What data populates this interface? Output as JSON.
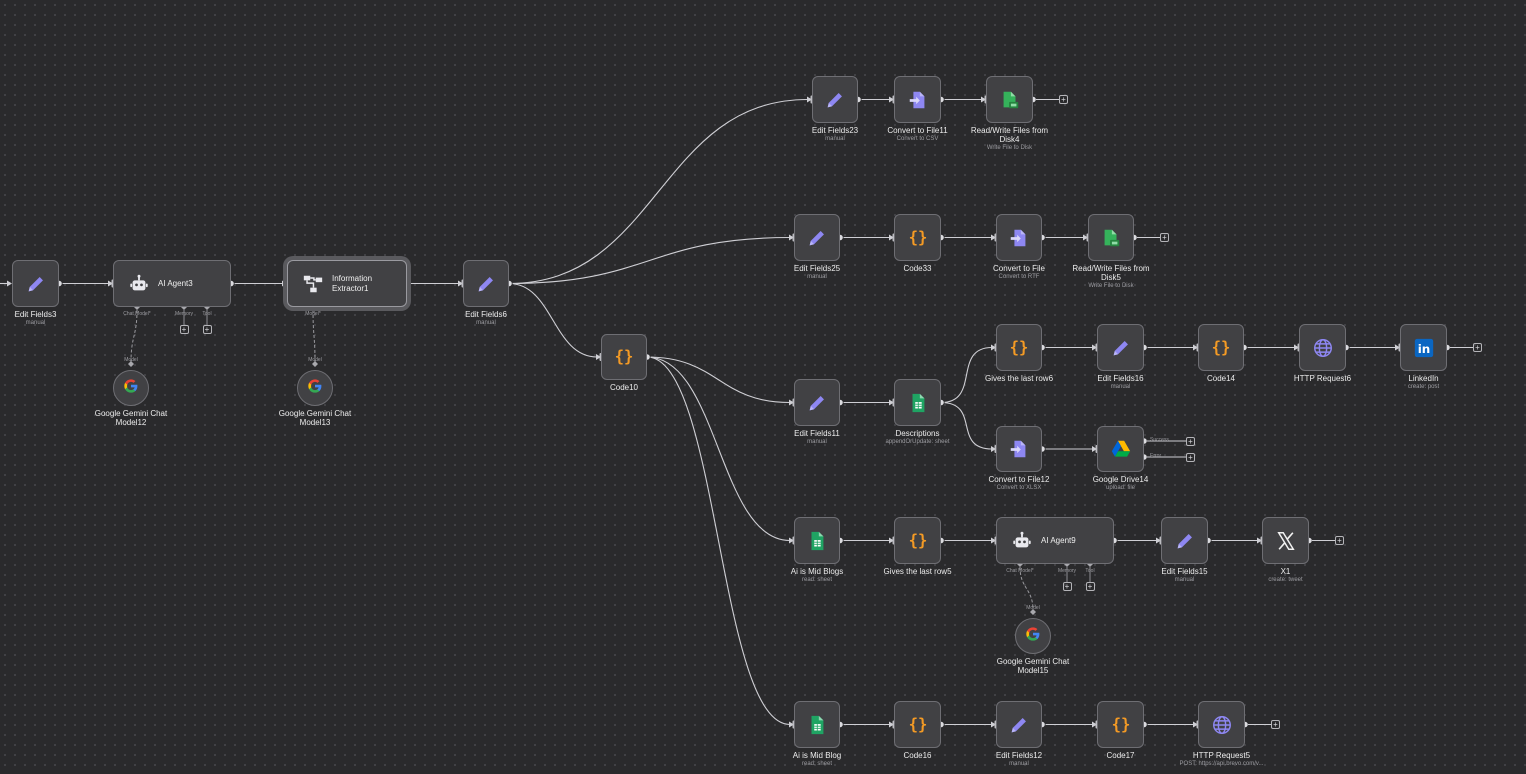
{
  "colors": {
    "canvas": "#2a2a2c",
    "node_fill": "#414144",
    "edge": "#cfcfd4",
    "pencil": "#8e87f2",
    "code_braces": "#f39a25",
    "sheets_green": "#1fa463",
    "file_purple": "#8e87f2",
    "linkedin_blue": "#0a66c2"
  },
  "nodes": {
    "edit_fields3": {
      "label": "Edit Fields3",
      "sub": "manual",
      "icon": "pencil-icon"
    },
    "ai_agent3": {
      "label": "AI Agent3",
      "icon": "robot-icon",
      "ports": [
        "Chat Model*",
        "Memory",
        "Tool"
      ]
    },
    "info_extractor1": {
      "label": "Information\nExtractor1",
      "icon": "tree-icon",
      "ports": [
        "Model*"
      ]
    },
    "gemini12": {
      "label": "Google Gemini Chat\nModel12",
      "top_label": "Model",
      "icon": "google-icon"
    },
    "gemini13": {
      "label": "Google Gemini Chat\nModel13",
      "top_label": "Model",
      "icon": "google-icon"
    },
    "edit_fields6": {
      "label": "Edit Fields6",
      "sub": "manual",
      "icon": "pencil-icon"
    },
    "code10": {
      "label": "Code10",
      "icon": "code-icon"
    },
    "edit_fields23": {
      "label": "Edit Fields23",
      "sub": "manual",
      "icon": "pencil-icon"
    },
    "convert_file11": {
      "label": "Convert to File11",
      "sub": "Convert to CSV",
      "icon": "file-convert-icon"
    },
    "rw_disk4": {
      "label": "Read/Write Files from\nDisk4",
      "sub": "Write File to Disk",
      "icon": "disk-file-icon"
    },
    "edit_fields25": {
      "label": "Edit Fields25",
      "sub": "manual",
      "icon": "pencil-icon"
    },
    "code33": {
      "label": "Code33",
      "icon": "code-icon"
    },
    "convert_file": {
      "label": "Convert to File",
      "sub": "Convert to RTF",
      "icon": "file-convert-icon"
    },
    "rw_disk5": {
      "label": "Read/Write Files from\nDisk5",
      "sub": "Write File to Disk",
      "icon": "disk-file-icon"
    },
    "edit_fields11": {
      "label": "Edit Fields11",
      "sub": "manual",
      "icon": "pencil-icon"
    },
    "descriptions": {
      "label": "Descriptions",
      "sub": "appendOrUpdate: sheet",
      "icon": "sheets-icon"
    },
    "gives_last_row6": {
      "label": "Gives the last row6",
      "icon": "code-icon"
    },
    "edit_fields16": {
      "label": "Edit Fields16",
      "sub": "manual",
      "icon": "pencil-icon"
    },
    "code14": {
      "label": "Code14",
      "icon": "code-icon"
    },
    "http_request6": {
      "label": "HTTP Request6",
      "icon": "globe-icon"
    },
    "linkedin": {
      "label": "LinkedIn",
      "sub": "create: post",
      "icon": "linkedin-icon"
    },
    "convert_file12": {
      "label": "Convert to File12",
      "sub": "Convert to XLSX",
      "icon": "file-convert-icon"
    },
    "google_drive14": {
      "label": "Google Drive14",
      "sub": "upload: file",
      "icon": "google-drive-icon",
      "outputs": [
        "Success",
        "Error"
      ]
    },
    "ai_is_mid_blogs": {
      "label": "Ai is Mid Blogs",
      "sub": "read: sheet",
      "icon": "sheets-icon"
    },
    "gives_last_row5": {
      "label": "Gives the last row5",
      "icon": "code-icon"
    },
    "ai_agent9": {
      "label": "AI Agent9",
      "icon": "robot-icon",
      "ports": [
        "Chat Model*",
        "Memory",
        "Tool"
      ]
    },
    "edit_fields15": {
      "label": "Edit Fields15",
      "sub": "manual",
      "icon": "pencil-icon"
    },
    "x1": {
      "label": "X1",
      "sub": "create: tweet",
      "icon": "x-icon"
    },
    "gemini15": {
      "label": "Google Gemini Chat\nModel15",
      "top_label": "Model",
      "icon": "google-icon"
    },
    "ai_is_mid_blog": {
      "label": "Ai is Mid Blog",
      "sub": "read: sheet",
      "icon": "sheets-icon"
    },
    "code16": {
      "label": "Code16",
      "icon": "code-icon"
    },
    "edit_fields12": {
      "label": "Edit Fields12",
      "sub": "manual",
      "icon": "pencil-icon"
    },
    "code17": {
      "label": "Code17",
      "icon": "code-icon"
    },
    "http_request5": {
      "label": "HTTP Request5",
      "sub": "POST: https://api.brevo.com/v...",
      "icon": "globe-icon"
    }
  },
  "add_button": "+"
}
